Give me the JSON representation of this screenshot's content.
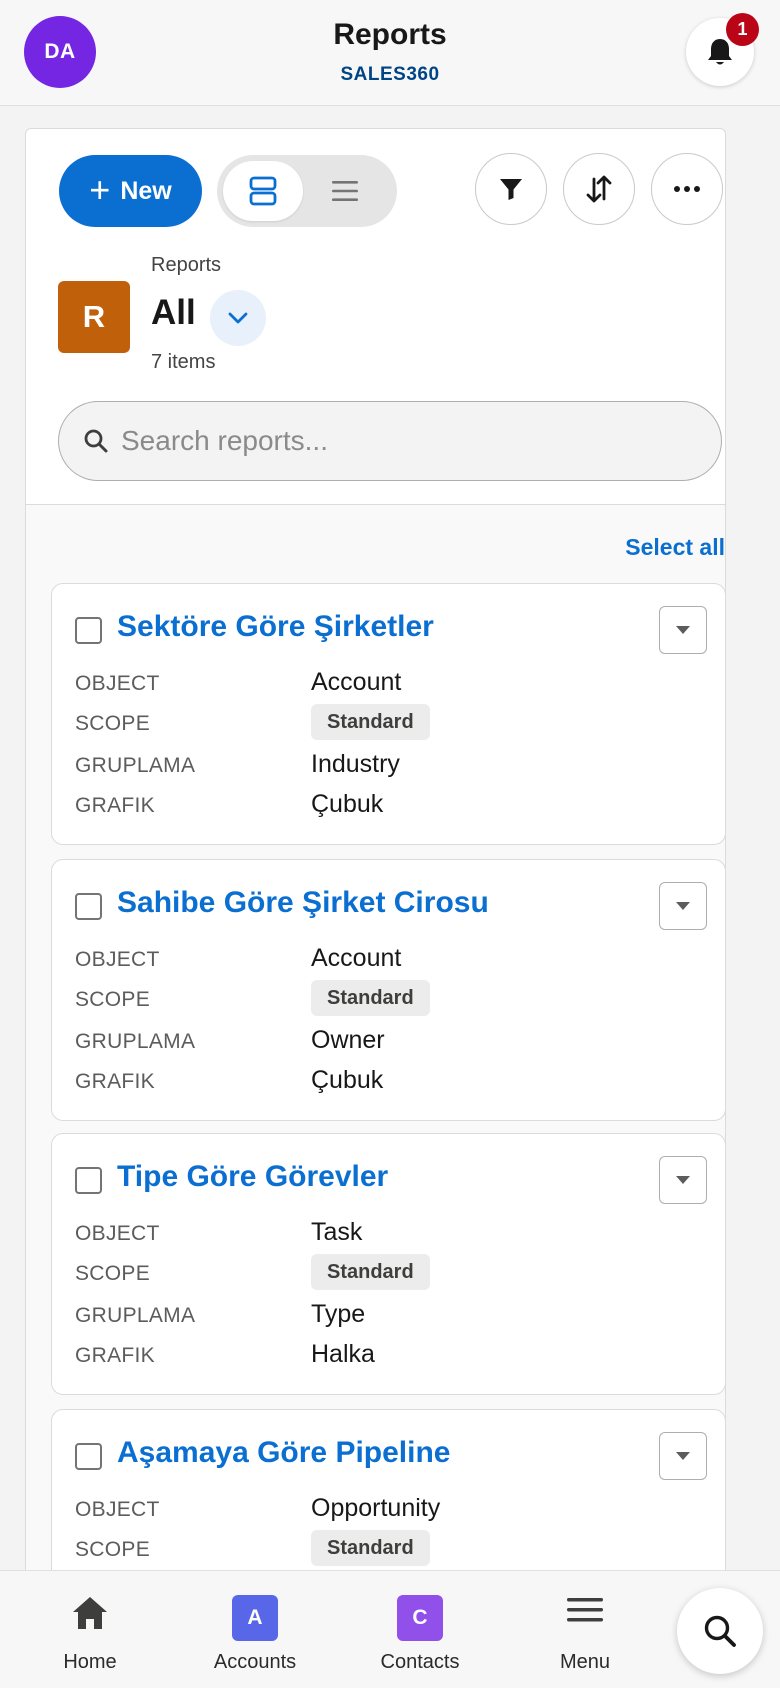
{
  "header": {
    "avatar_initials": "DA",
    "avatar_color": "#7526e3",
    "title": "Reports",
    "subtitle": "SALES360",
    "notification_count": "1"
  },
  "toolbar": {
    "new_label": "New",
    "icons": [
      "plus-icon",
      "card-view-icon",
      "list-view-icon",
      "filter-icon",
      "sort-icon",
      "more-icon"
    ]
  },
  "list_view": {
    "object_tile_letter": "R",
    "object_tile_color": "#c0600b",
    "object_label": "Reports",
    "name": "All",
    "item_count": "7 items"
  },
  "search": {
    "placeholder": "Search reports..."
  },
  "select_all_label": "Select all",
  "field_labels": {
    "object": "OBJECT",
    "scope": "SCOPE",
    "grouping": "GRUPLAMA",
    "chart": "GRAFIK"
  },
  "reports": [
    {
      "title": "Sektöre Göre Şirketler",
      "object": "Account",
      "scope": "Standard",
      "grouping": "Industry",
      "chart": "Çubuk"
    },
    {
      "title": "Sahibe Göre Şirket Cirosu",
      "object": "Account",
      "scope": "Standard",
      "grouping": "Owner",
      "chart": "Çubuk"
    },
    {
      "title": "Tipe Göre Görevler",
      "object": "Task",
      "scope": "Standard",
      "grouping": "Type",
      "chart": "Halka"
    },
    {
      "title": "Aşamaya Göre Pipeline",
      "object": "Opportunity",
      "scope": "Standard"
    }
  ],
  "bottom_nav": {
    "home": "Home",
    "accounts": "Accounts",
    "accounts_letter": "A",
    "accounts_color": "#5867e8",
    "contacts": "Contacts",
    "contacts_letter": "C",
    "contacts_color": "#9050e9",
    "menu": "Menu"
  },
  "colors": {
    "brand_blue": "#0b6fd1",
    "link_blue": "#0b6fd1",
    "badge_red": "#ba0517"
  }
}
